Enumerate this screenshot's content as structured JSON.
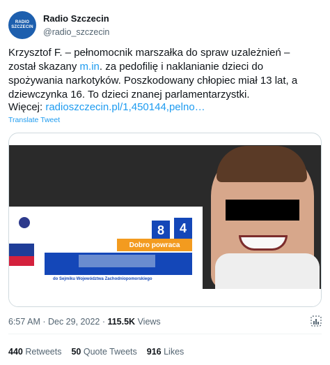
{
  "account": {
    "display_name": "Radio Szczecin",
    "handle": "@radio_szczecin",
    "avatar_text_1": "RADIO",
    "avatar_text_2": "SZCZECIN"
  },
  "tweet": {
    "text_part1": "Krzysztof F. – pełnomocnik marszałka do spraw uzależnień – został skazany ",
    "text_link": "m.in",
    "text_part2": ". za pedofilię i naklanianie dzieci do spożywania narkotyków. Poszkodowany chłopiec miał 13 lat, a dziewczynka 16. To dzieci znanej parlamentarzystki.",
    "more_label": "Więcej: ",
    "more_link": "radioszczecin.pl/1,450144,pelno…",
    "translate_label": "Translate Tweet"
  },
  "media": {
    "banner_heading": "Dobro powraca",
    "number_1": "8",
    "number_2": "4",
    "sejmik_text": "do Sejmiku Województwa Zachodniopomorskiego"
  },
  "meta": {
    "time": "6:57 AM",
    "date": "Dec 29, 2022",
    "views_count": "115.5K",
    "views_label": "Views",
    "analytics_icon": "analytics-icon"
  },
  "stats": {
    "retweets_count": "440",
    "retweets_label": "Retweets",
    "quotes_count": "50",
    "quotes_label": "Quote Tweets",
    "likes_count": "916",
    "likes_label": "Likes"
  },
  "colors": {
    "link": "#1d9bf0",
    "secondary_text": "#536471",
    "primary_text": "#0f1419"
  }
}
